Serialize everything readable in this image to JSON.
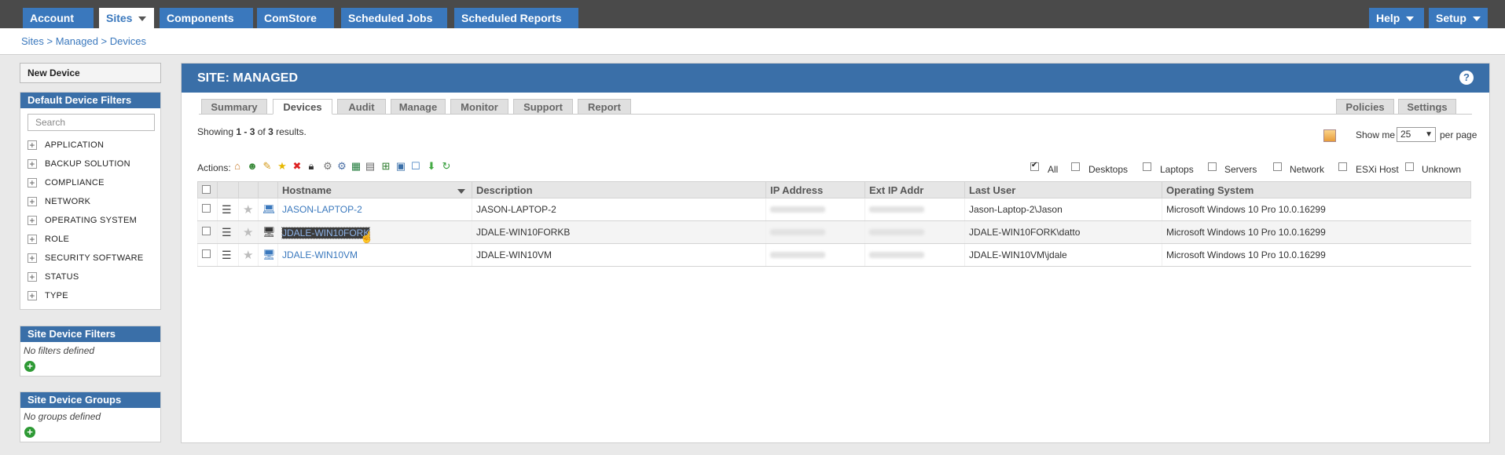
{
  "topnav": {
    "left": [
      "Account",
      "Sites",
      "Components",
      "ComStore",
      "Scheduled Jobs",
      "Scheduled Reports"
    ],
    "right": [
      "Help",
      "Setup"
    ],
    "active": "Sites"
  },
  "breadcrumb": "Sites > Managed > Devices",
  "sidebar": {
    "new_device": "New Device",
    "default_filters_title": "Default Device Filters",
    "search_placeholder": "Search",
    "filters": [
      "APPLICATION",
      "BACKUP SOLUTION",
      "COMPLIANCE",
      "NETWORK",
      "OPERATING SYSTEM",
      "ROLE",
      "SECURITY SOFTWARE",
      "STATUS",
      "TYPE"
    ],
    "site_filters_title": "Site Device Filters",
    "site_filters_empty": "No filters defined",
    "site_groups_title": "Site Device Groups",
    "site_groups_empty": "No groups defined"
  },
  "main": {
    "title": "SITE: MANAGED",
    "tabs": [
      "Summary",
      "Devices",
      "Audit",
      "Manage",
      "Monitor",
      "Support",
      "Report"
    ],
    "active_tab": "Devices",
    "right_tabs": [
      "Policies",
      "Settings"
    ],
    "showing_prefix": "Showing ",
    "showing_range": "1 - 3",
    "showing_of": " of ",
    "showing_total": "3",
    "showing_suffix": " results.",
    "show_me_label": "Show me",
    "show_me_value": "25",
    "per_page_label": "per page",
    "actions_label": "Actions:",
    "type_filters": [
      {
        "label": "All",
        "checked": true
      },
      {
        "label": "Desktops",
        "checked": false
      },
      {
        "label": "Laptops",
        "checked": false
      },
      {
        "label": "Servers",
        "checked": false
      },
      {
        "label": "Network",
        "checked": false
      },
      {
        "label": "ESXi Host",
        "checked": false
      },
      {
        "label": "Unknown",
        "checked": false
      }
    ]
  },
  "table": {
    "columns": [
      "Hostname",
      "Description",
      "IP Address",
      "Ext IP Addr",
      "Last User",
      "Operating System"
    ],
    "rows": [
      {
        "hostname": "JASON-LAPTOP-2",
        "description": "JASON-LAPTOP-2",
        "last_user": "Jason-Laptop-2\\Jason",
        "os": "Microsoft Windows 10 Pro 10.0.16299",
        "device_icon": "laptop-icon"
      },
      {
        "hostname": "JDALE-WIN10FORK",
        "description": "JDALE-WIN10FORKB",
        "last_user": "JDALE-WIN10FORK\\datto",
        "os": "Microsoft Windows 10 Pro 10.0.16299",
        "device_icon": "desktop-icon"
      },
      {
        "hostname": "JDALE-WIN10VM",
        "description": "JDALE-WIN10VM",
        "last_user": "JDALE-WIN10VM\\jdale",
        "os": "Microsoft Windows 10 Pro 10.0.16299",
        "device_icon": "desktop-icon"
      }
    ]
  },
  "colors": {
    "brand_blue": "#3a6fa8",
    "nav_blue": "#3a78bd",
    "topbar": "#4a4a4a"
  }
}
